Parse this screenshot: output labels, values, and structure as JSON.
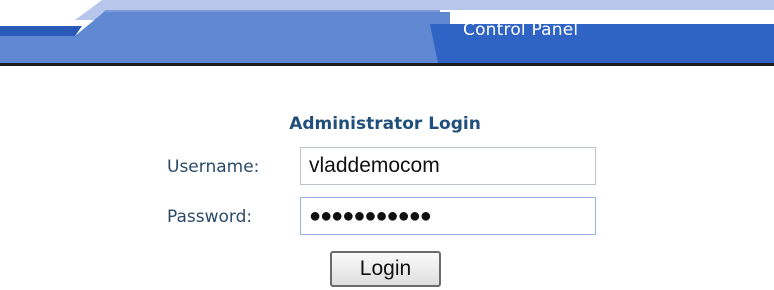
{
  "header": {
    "title": "Control Panel"
  },
  "login": {
    "title": "Administrator Login",
    "username_label": "Username:",
    "username_value": "vladdemocom",
    "password_label": "Password:",
    "password_mask": "●●●●●●●●●●●",
    "submit_label": "Login"
  },
  "colors": {
    "header_dark": "#2d62c0",
    "header_mid": "#4f82d3",
    "header_light": "#8ea8e0",
    "title_blue": "#1f4f7a",
    "label_blue": "#2b4a6b"
  }
}
